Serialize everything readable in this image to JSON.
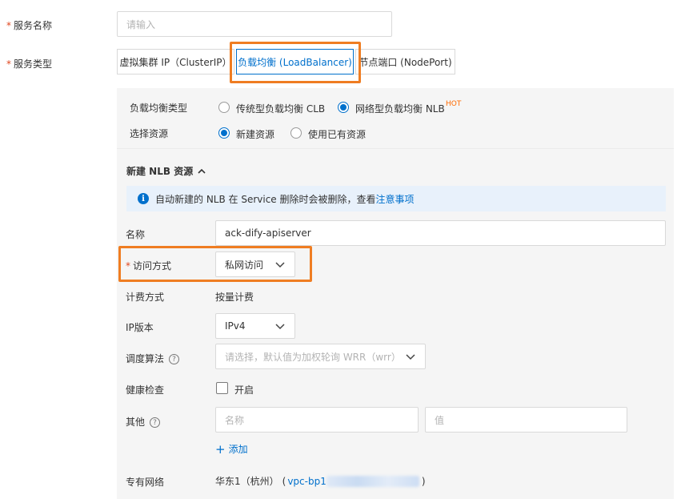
{
  "form": {
    "service_name": {
      "label": "服务名称",
      "placeholder": "请输入"
    },
    "service_type": {
      "label": "服务类型",
      "options": [
        "虚拟集群 IP（ClusterIP）",
        "负载均衡 (LoadBalancer)",
        "节点端口 (NodePort)"
      ],
      "selected": "负载均衡 (LoadBalancer)"
    }
  },
  "lb_settings": {
    "lb_type_label": "负载均衡类型",
    "lb_type_options": [
      "传统型负载均衡 CLB",
      "网络型负载均衡 NLB"
    ],
    "lb_type_selected": "网络型负载均衡 NLB",
    "hot_badge": "HOT",
    "resource_label": "选择资源",
    "resource_options": [
      "新建资源",
      "使用已有资源"
    ],
    "resource_selected": "新建资源"
  },
  "nlb": {
    "section_title": "新建 NLB 资源",
    "info_text": "自动新建的 NLB 在 Service 删除时会被删除，查看",
    "info_link": "注意事项",
    "name_label": "名称",
    "name_value": "ack-dify-apiserver",
    "access_label": "访问方式",
    "access_value": "私网访问",
    "billing_label": "计费方式",
    "billing_value": "按量计费",
    "ip_version_label": "IP版本",
    "ip_version_value": "IPv4",
    "scheduling_label": "调度算法",
    "scheduling_placeholder": "请选择，默认值为加权轮询 WRR（wrr）",
    "health_label": "健康检查",
    "health_checkbox_label": "开启",
    "health_enabled": false,
    "other_label": "其他",
    "other_name_placeholder": "名称",
    "other_value_placeholder": "值",
    "add_label": "添加",
    "vpc_label": "专有网络",
    "vpc_region": "华东1（杭州）",
    "vpc_open": "(",
    "vpc_id_prefix": "vpc-bp1",
    "vpc_close": ")"
  },
  "colors": {
    "primary": "#0070cc",
    "highlight_border": "#ef7d22",
    "required": "#e0461e",
    "hot": "#ff6a00"
  }
}
